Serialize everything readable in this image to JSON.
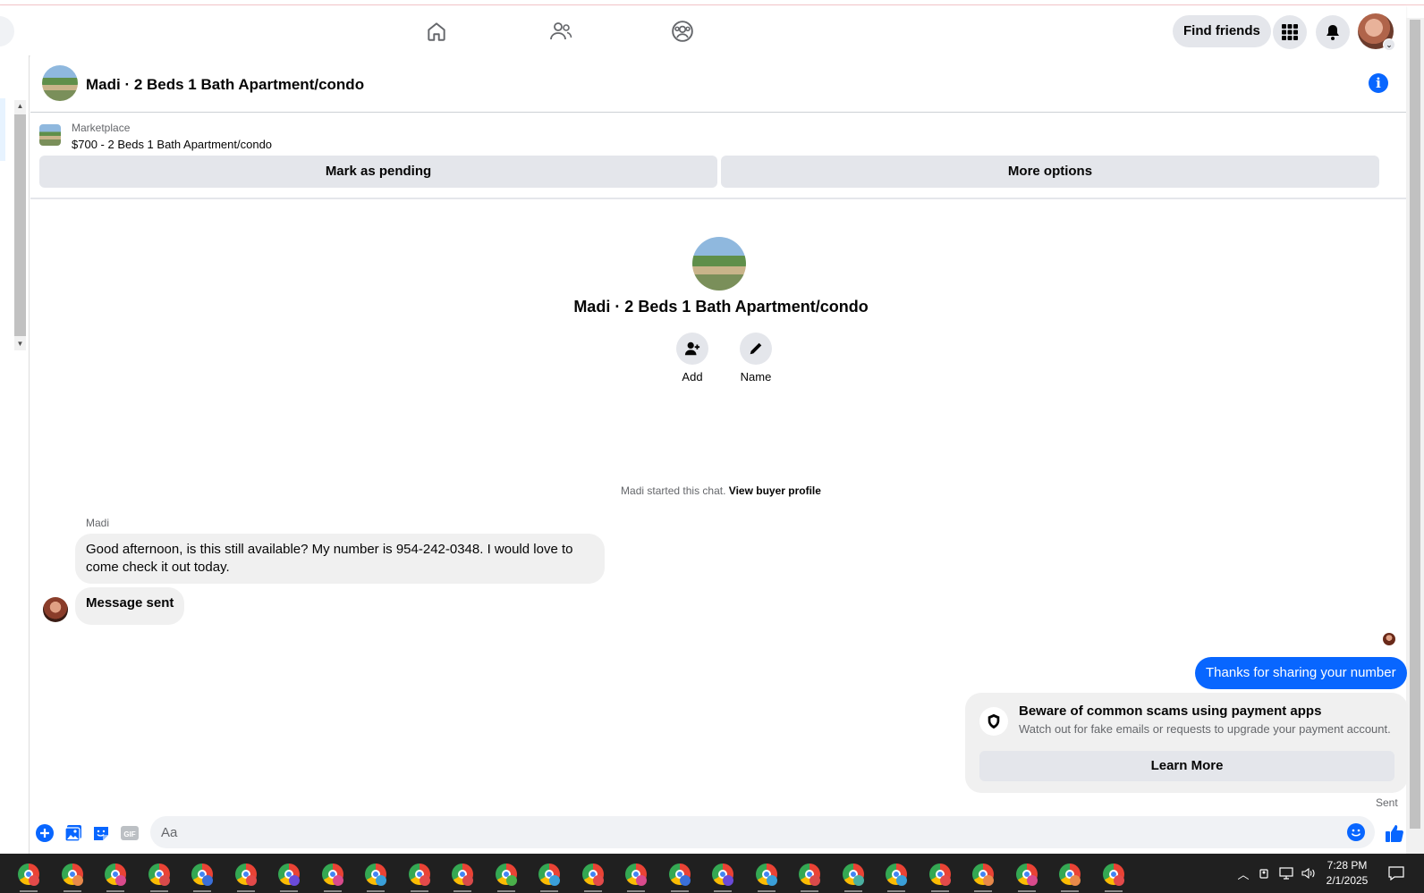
{
  "topbar": {
    "find_friends_label": "Find friends",
    "nav_icons": [
      "home-icon",
      "friends-icon",
      "groups-icon"
    ],
    "right_icons": [
      "apps-grid-icon",
      "notifications-bell-icon"
    ]
  },
  "conversation": {
    "title": "Madi · 2 Beds 1 Bath Apartment/condo"
  },
  "listing": {
    "source": "Marketplace",
    "price_title": "$700 - 2 Beds 1 Bath Apartment/condo",
    "mark_pending_label": "Mark as pending",
    "more_options_label": "More options"
  },
  "profile": {
    "title": "Madi · 2 Beds 1 Bath Apartment/condo",
    "add_label": "Add",
    "name_label": "Name"
  },
  "system": {
    "started_text": "Madi started this chat.",
    "view_profile_label": "View buyer profile"
  },
  "messages": {
    "sender": "Madi",
    "incoming_1": "Good afternoon, is this still available? My number is 954-242-0348. I would love to come check it out today.",
    "incoming_2": "Message sent",
    "outgoing_1": "Thanks for sharing your number",
    "status": "Sent"
  },
  "scam_warning": {
    "title": "Beware of common scams using payment apps",
    "description": "Watch out for fake emails or requests to upgrade your payment account.",
    "button_label": "Learn More"
  },
  "composer": {
    "placeholder": "Aa"
  },
  "colors": {
    "accent": "#0866ff",
    "bubble_in": "#f0f0f0",
    "button_gray": "#e4e6eb",
    "taskbar": "#202020"
  },
  "taskbar": {
    "app_count": 26,
    "badge_colors": [
      "#e34a4a",
      "#e8894a",
      "#d94a8c",
      "#d94a4a",
      "#3a6fd9",
      "#e34a4a",
      "#6a4ad9",
      "#d94a8c",
      "#3a9fd9",
      "#e34a4a",
      "#d94a4a",
      "#4ab04a",
      "#3a9fd9",
      "#e34a4a",
      "#d94a8c",
      "#3a6fd9",
      "#6a4ad9",
      "#3a9fd9",
      "#d94a4a",
      "#4ab0a0",
      "#3a9fd9",
      "#e34a4a",
      "#e8894a",
      "#d94a8c",
      "#e8894a",
      "#e34a4a"
    ],
    "time": "7:28 PM",
    "date": "2/1/2025"
  }
}
